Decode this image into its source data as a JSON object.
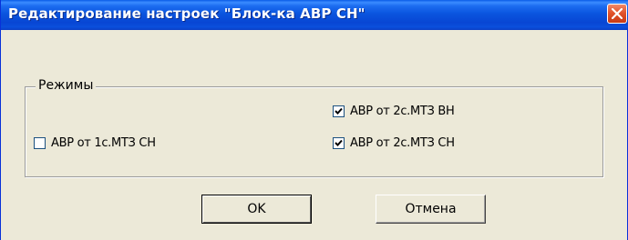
{
  "window": {
    "title": "Редактирование настроек \"Блок-ка АВР СН\""
  },
  "group": {
    "label": "Режимы",
    "options": [
      {
        "label": "АВР от 2с.МТЗ ВН",
        "checked": true
      },
      {
        "label": "АВР от 1с.МТЗ СН",
        "checked": false
      },
      {
        "label": "АВР от 2с.МТЗ СН",
        "checked": true
      }
    ]
  },
  "buttons": {
    "ok_label": "OK",
    "cancel_label": "Отмена"
  },
  "icons": {
    "close": "close-icon",
    "check": "checkmark-icon"
  },
  "colors": {
    "titlebar": "#0a55df",
    "close": "#e2542c",
    "face": "#ece9d8"
  }
}
